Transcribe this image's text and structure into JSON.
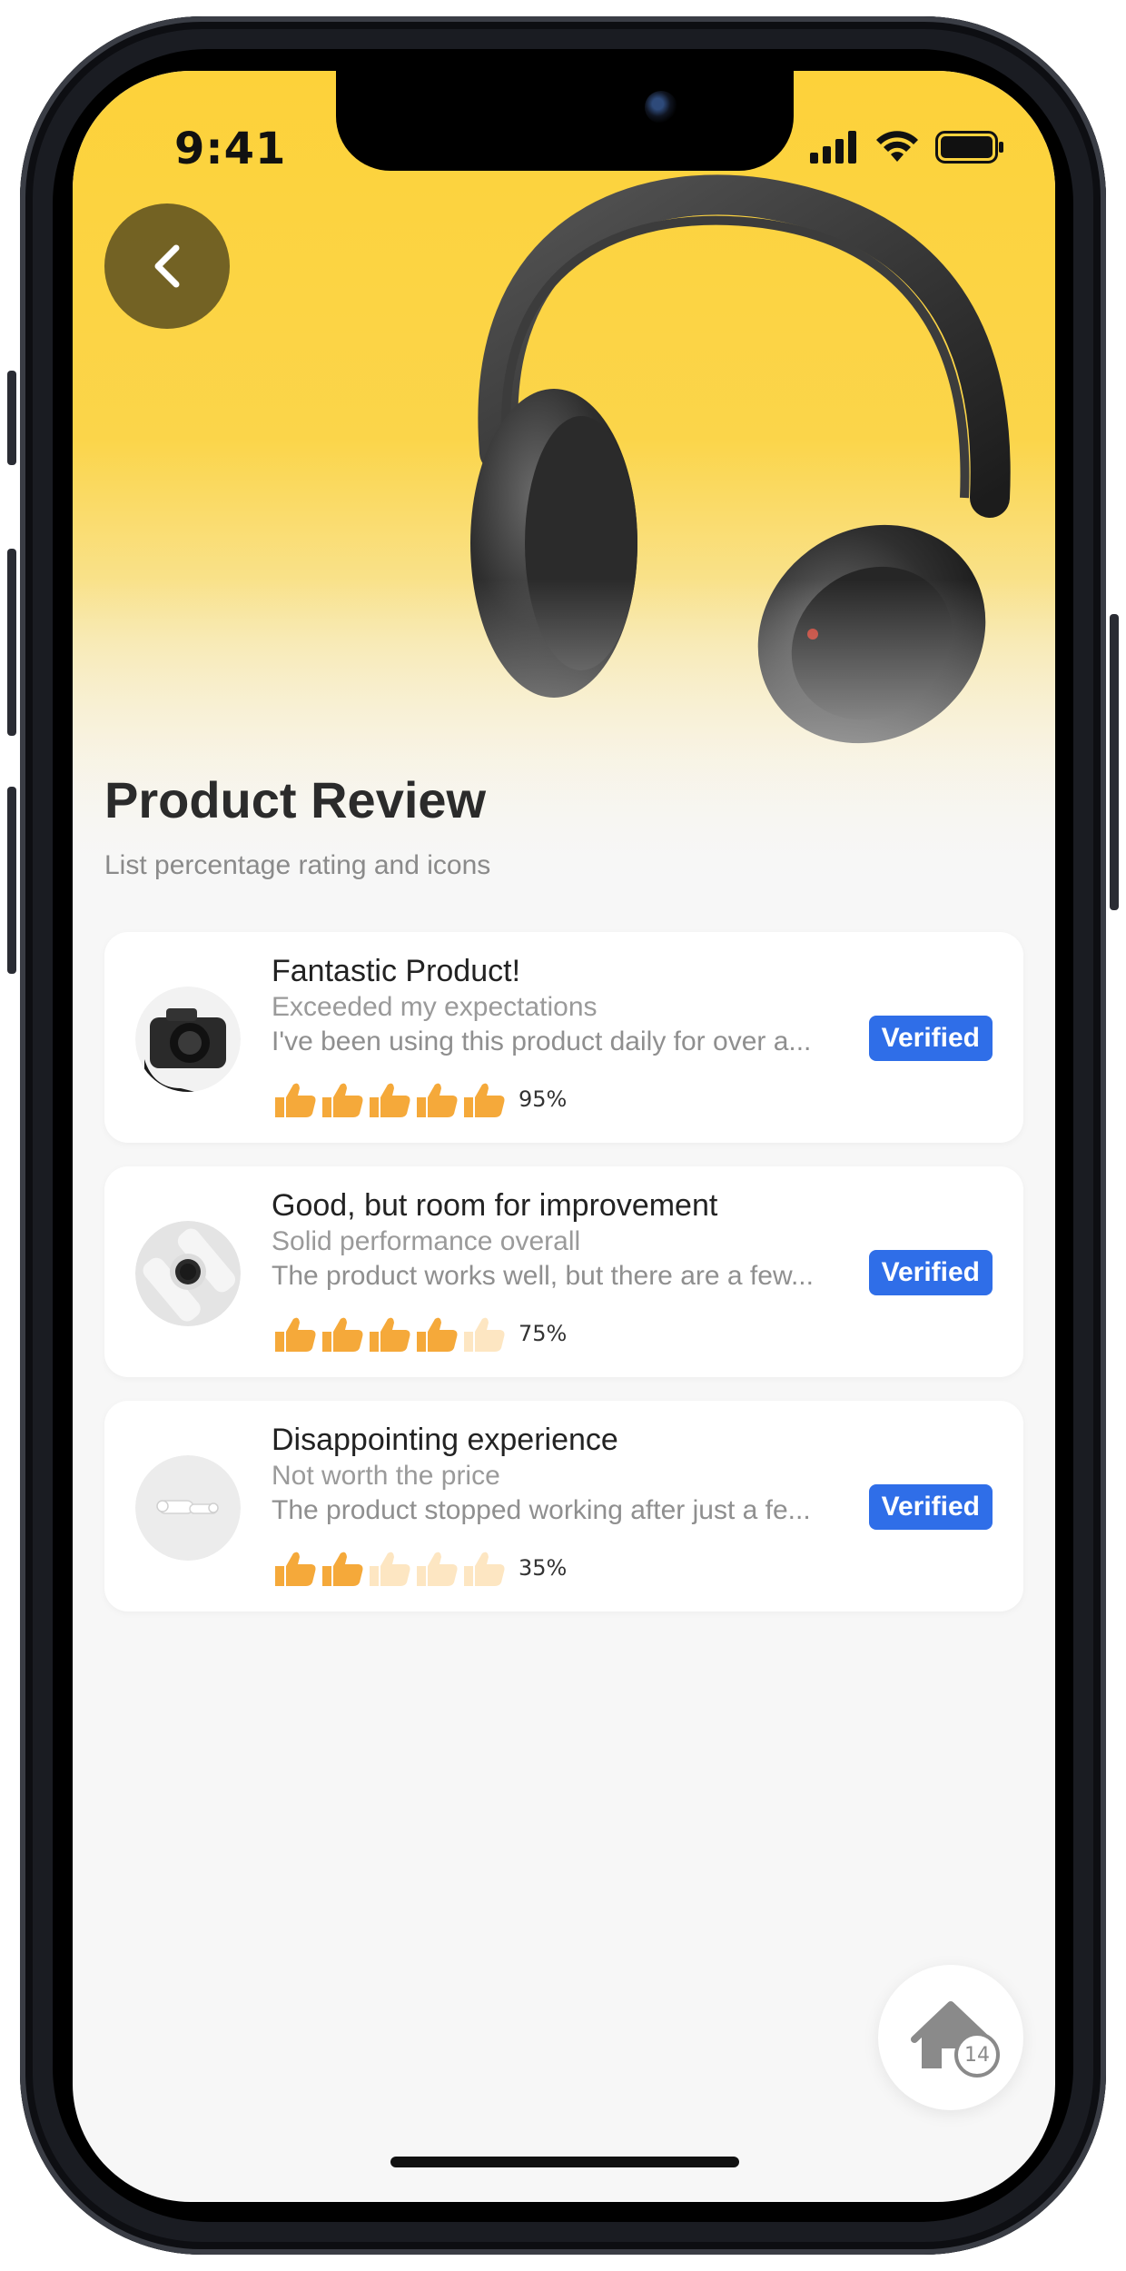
{
  "status_bar": {
    "time": "9:41"
  },
  "header": {
    "title": "Product Review",
    "subtitle": "List percentage rating and icons"
  },
  "reviews": [
    {
      "title": "Fantastic Product!",
      "subtitle": "Exceeded my expectations",
      "body": "I've been using this product daily for over a...",
      "badge": "Verified",
      "rating_percent": 95,
      "rating_label": "95%",
      "filled_icons": 5,
      "image": "camera-photo"
    },
    {
      "title": "Good, but room for improvement",
      "subtitle": "Solid performance overall",
      "body": "The product works well, but there are a few...",
      "badge": "Verified",
      "rating_percent": 75,
      "rating_label": "75%",
      "filled_icons": 4,
      "image": "smartwatch-photo"
    },
    {
      "title": "Disappointing experience",
      "subtitle": "Not worth the price",
      "body": "The product stopped working after just a fe...",
      "badge": "Verified",
      "rating_percent": 35,
      "rating_label": "35%",
      "filled_icons": 2,
      "image": "earbuds-photo"
    }
  ],
  "fab": {
    "badge_count": "14",
    "icon": "home-icon"
  },
  "colors": {
    "accent_yellow": "#fdd23a",
    "verified_blue": "#2f6ee8",
    "thumb_filled": "#f5a93a",
    "thumb_empty": "#fde6c2"
  }
}
